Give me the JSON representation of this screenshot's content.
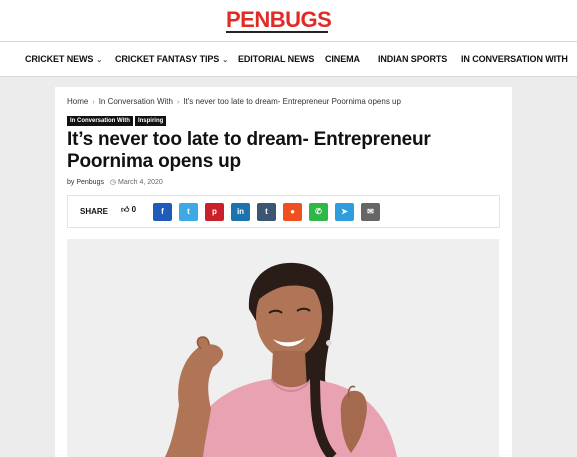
{
  "logo": {
    "part1": "PEN",
    "part2": "BUGS"
  },
  "nav": [
    {
      "label": "CRICKET NEWS",
      "dropdown": true
    },
    {
      "label": "CRICKET FANTASY TIPS",
      "dropdown": true
    },
    {
      "label": "EDITORIAL NEWS",
      "dropdown": false
    },
    {
      "label": "CINEMA",
      "dropdown": false
    },
    {
      "label": "INDIAN SPORTS",
      "dropdown": false
    },
    {
      "label": "IN CONVERSATION WITH",
      "dropdown": false
    }
  ],
  "breadcrumb": {
    "home": "Home",
    "category": "In Conversation With",
    "current": "It's never too late to dream- Entrepreneur Poornima opens up",
    "separator": "›"
  },
  "tags": [
    "In Conversation With",
    "Inspiring"
  ],
  "article": {
    "title": "It’s never too late to dream- Entrepreneur Poornima opens up",
    "author": "by Penbugs",
    "date": "March 4, 2020"
  },
  "share": {
    "label": "SHARE",
    "likes": "0",
    "buttons": [
      {
        "icon": "facebook-icon",
        "glyph": "f",
        "color": "#1f5bb8"
      },
      {
        "icon": "twitter-icon",
        "glyph": "t",
        "color": "#3fa9e6"
      },
      {
        "icon": "pinterest-icon",
        "glyph": "p",
        "color": "#c9202a"
      },
      {
        "icon": "linkedin-icon",
        "glyph": "in",
        "color": "#1c73ad"
      },
      {
        "icon": "tumblr-icon",
        "glyph": "t",
        "color": "#3a5670"
      },
      {
        "icon": "reddit-icon",
        "glyph": "●",
        "color": "#f0501f"
      },
      {
        "icon": "whatsapp-icon",
        "glyph": "✆",
        "color": "#2fb847"
      },
      {
        "icon": "telegram-icon",
        "glyph": "➤",
        "color": "#2e9ddb"
      },
      {
        "icon": "email-icon",
        "glyph": "✉",
        "color": "#666666"
      }
    ]
  },
  "colors": {
    "accent": "#e02b26",
    "text": "#111111",
    "page_bg": "#ececec"
  }
}
